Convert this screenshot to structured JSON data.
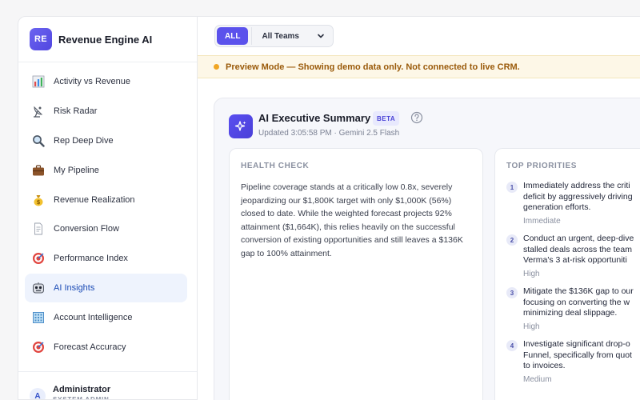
{
  "brand": {
    "logo": "RE",
    "name": "Revenue Engine AI"
  },
  "sidebar": {
    "items": [
      {
        "label": "Activity vs Revenue",
        "icon": "bar-chart-icon"
      },
      {
        "label": "Risk Radar",
        "icon": "satellite-dish-icon"
      },
      {
        "label": "Rep Deep Dive",
        "icon": "magnifier-icon"
      },
      {
        "label": "My Pipeline",
        "icon": "briefcase-icon"
      },
      {
        "label": "Revenue Realization",
        "icon": "money-bag-icon"
      },
      {
        "label": "Conversion Flow",
        "icon": "document-icon"
      },
      {
        "label": "Performance Index",
        "icon": "target-icon"
      },
      {
        "label": "AI Insights",
        "icon": "robot-icon"
      },
      {
        "label": "Account Intelligence",
        "icon": "building-icon"
      },
      {
        "label": "Forecast Accuracy",
        "icon": "target-icon"
      }
    ],
    "active_index": 7
  },
  "user": {
    "initial": "A",
    "name": "Administrator",
    "role": "SYSTEM ADMIN"
  },
  "filters": {
    "all_label": "ALL",
    "team_select": "All Teams"
  },
  "banner": {
    "text": "Preview Mode — Showing demo data only. Not connected to live CRM."
  },
  "summary": {
    "title": "AI Executive Summary",
    "badge": "BETA",
    "updated": "Updated 3:05:58 PM · Gemini 2.5 Flash",
    "health": {
      "heading": "HEALTH CHECK",
      "text": "Pipeline coverage stands at a critically low 0.8x, severely jeopardizing our $1,800K target with only $1,000K (56%) closed to date. While the weighted forecast projects 92% attainment ($1,664K), this relies heavily on the successful conversion of existing opportunities and still leaves a $136K gap to 100% attainment."
    },
    "priorities": {
      "heading": "TOP PRIORITIES",
      "items": [
        {
          "num": "1",
          "lines": [
            "Immediately address the criti",
            "deficit by aggressively driving",
            "generation efforts."
          ],
          "level": "Immediate"
        },
        {
          "num": "2",
          "lines": [
            "Conduct an urgent, deep-dive",
            "stalled deals across the team",
            "Verma's 3 at-risk opportuniti"
          ],
          "level": "High"
        },
        {
          "num": "3",
          "lines": [
            "Mitigate the $136K gap to our",
            "focusing on converting the w",
            "minimizing deal slippage."
          ],
          "level": "High"
        },
        {
          "num": "4",
          "lines": [
            "Investigate significant drop-o",
            "Funnel, specifically from quot",
            "to invoices."
          ],
          "level": "Medium"
        }
      ]
    }
  },
  "colors": {
    "accent": "#5b52ec",
    "active_nav_bg": "#eef3fd",
    "banner_bg": "#fdf7e7",
    "banner_dot": "#f0a523"
  }
}
